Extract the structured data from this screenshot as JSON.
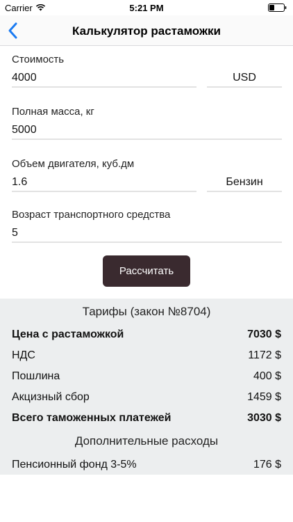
{
  "status_bar": {
    "carrier": "Carrier",
    "time": "5:21 PM"
  },
  "nav": {
    "title": "Калькулятор растаможки"
  },
  "form": {
    "cost": {
      "label": "Стоимость",
      "value": "4000",
      "currency": "USD"
    },
    "mass": {
      "label": "Полная масса, кг",
      "value": "5000"
    },
    "engine": {
      "label": "Объем двигателя, куб.дм",
      "value": "1.6",
      "fuel": "Бензин"
    },
    "age": {
      "label": "Возраст транспортного средства",
      "value": "5"
    },
    "calculate_label": "Рассчитать"
  },
  "results": {
    "tariffs_heading": "Тарифы (закон №8704)",
    "rows": [
      {
        "label": "Цена с растаможкой",
        "value": "7030 $",
        "bold": true
      },
      {
        "label": "НДС",
        "value": "1172 $",
        "bold": false
      },
      {
        "label": "Пошлина",
        "value": "400 $",
        "bold": false
      },
      {
        "label": "Акцизный сбор",
        "value": "1459 $",
        "bold": false
      },
      {
        "label": "Всего таможенных платежей",
        "value": "3030 $",
        "bold": true
      }
    ],
    "extra_heading": "Дополнительные расходы",
    "extra_rows": [
      {
        "label": "Пенсионный фонд 3-5%",
        "value": "176 $"
      }
    ]
  },
  "colors": {
    "button_bg": "#3a2a2f",
    "accent": "#1a7bf2",
    "results_bg": "#eceeef"
  }
}
